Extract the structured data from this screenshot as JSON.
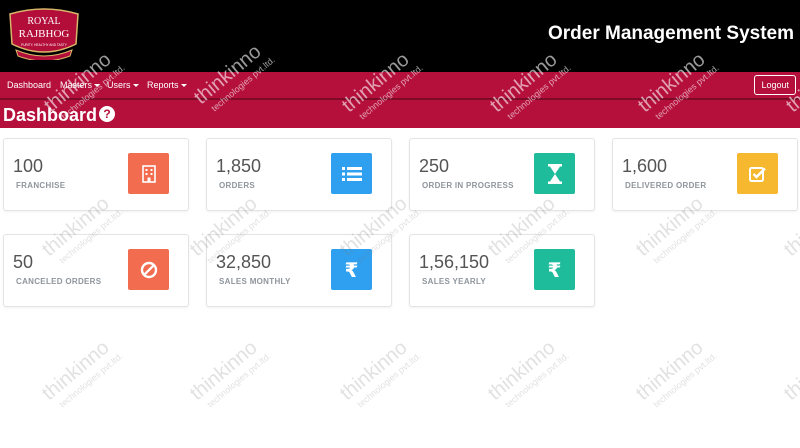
{
  "logo": {
    "line1": "ROYAL",
    "line2": "RAJBHOG",
    "tagline": "PURITY, HEALTHY AND TASTY",
    "colors": {
      "badge": "#b30d3a",
      "border": "#d9b76a",
      "text": "#ffffff"
    }
  },
  "header": {
    "title": "Order Management System"
  },
  "nav": {
    "items": [
      {
        "label": "Dashboard",
        "has_caret": false
      },
      {
        "label": "Masters",
        "has_caret": true
      },
      {
        "label": "Users",
        "has_caret": true
      },
      {
        "label": "Reports",
        "has_caret": true
      }
    ],
    "logout_label": "Logout"
  },
  "page": {
    "title": "Dashboard",
    "help_icon": "question-circle-icon"
  },
  "cards": [
    {
      "value": "100",
      "label": "FRANCHISE",
      "icon": "building-icon",
      "color": "#f26c4f"
    },
    {
      "value": "1,850",
      "label": "ORDERS",
      "icon": "list-icon",
      "color": "#2fa0f0"
    },
    {
      "value": "250",
      "label": "ORDER IN PROGRESS",
      "icon": "hourglass-icon",
      "color": "#1fbc9c"
    },
    {
      "value": "1,600",
      "label": "DELIVERED ORDER",
      "icon": "check-square-icon",
      "color": "#f5b82e"
    },
    {
      "value": "50",
      "label": "CANCELED ORDERS",
      "icon": "ban-icon",
      "color": "#f26c4f"
    },
    {
      "value": "32,850",
      "label": "SALES MONTHLY",
      "icon": "rupee-icon",
      "color": "#2fa0f0"
    },
    {
      "value": "1,56,150",
      "label": "SALES YEARLY",
      "icon": "rupee-icon",
      "color": "#1fbc9c"
    }
  ],
  "icons": {
    "rupee_symbol": "₹"
  },
  "watermark": {
    "line1": "thinkinno",
    "line2": "technologies pvt.ltd."
  },
  "colors": {
    "header_bg": "#000000",
    "nav_bg": "#b5103c",
    "title_border": "#7c0a28"
  }
}
